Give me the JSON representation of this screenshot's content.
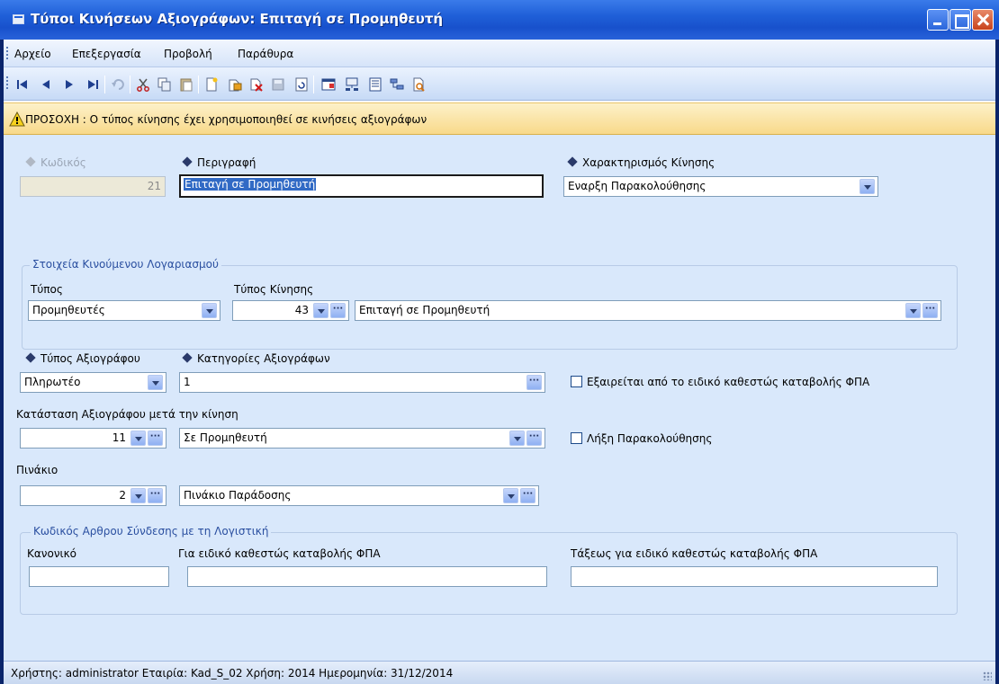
{
  "window": {
    "title": "Τύποι Κινήσεων Αξιογράφων: Επιταγή σε Προμηθευτή"
  },
  "menu": {
    "items": [
      {
        "label": "Αρχείο"
      },
      {
        "label": "Επεξεργασία"
      },
      {
        "label": "Προβολή"
      },
      {
        "label": "Παράθυρα"
      }
    ]
  },
  "toolbar": {
    "icons": [
      "first-icon",
      "previous-icon",
      "next-icon",
      "last-icon",
      "undo-icon",
      "cut-icon",
      "copy-icon",
      "paste-icon",
      "new-icon",
      "new-copy-icon",
      "delete-icon",
      "save-icon",
      "refresh-icon",
      "form-icon",
      "network-icon",
      "list-icon",
      "tree-icon",
      "report-icon"
    ]
  },
  "warning": {
    "text": "ΠΡΟΣΟΧΗ : Ο τύπος κίνησης έχει χρησιμοποιηθεί σε κινήσεις αξιογράφων"
  },
  "form": {
    "code": {
      "label": "Κωδικός",
      "value": "21"
    },
    "description": {
      "label": "Περιγραφή",
      "value": "Επιταγή σε Προμηθευτή"
    },
    "movement_char": {
      "label": "Χαρακτηρισμός Κίνησης",
      "value": "Εναρξη Παρακολούθησης"
    },
    "account_group": {
      "title": "Στοιχεία Κινούμενου Λογαριασμού",
      "type_label": "Τύπος",
      "type_value": "Προμηθευτές",
      "movement_type_label": "Τύπος Κίνησης",
      "movement_type_code": "43",
      "movement_type_desc": "Επιταγή σε Προμηθευτή"
    },
    "doc_type": {
      "label": "Τύπος Αξιογράφου",
      "value": "Πληρωτέο"
    },
    "doc_categories": {
      "label": "Κατηγορίες Αξιογράφων",
      "value": "1"
    },
    "vat_exempt": {
      "label": "Εξαιρείται από το ειδικό καθεστώς καταβολής ΦΠΑ",
      "checked": false
    },
    "state_after": {
      "label": "Κατάσταση Αξιογράφου μετά την κίνηση",
      "code": "11",
      "desc": "Σε Προμηθευτή"
    },
    "end_tracking": {
      "label": "Λήξη Παρακολούθησης",
      "checked": false
    },
    "board": {
      "label": "Πινάκιο",
      "code": "2",
      "desc": "Πινάκιο Παράδοσης"
    },
    "accounting_group": {
      "title": "Κωδικός Αρθρου Σύνδεσης με τη Λογιστική",
      "normal_label": "Κανονικό",
      "normal_value": "",
      "special_label": "Για ειδικό καθεστώς καταβολής ΦΠΑ",
      "special_value": "",
      "orders_label": "Τάξεως για ειδικό καθεστώς καταβολής ΦΠΑ",
      "orders_value": ""
    }
  },
  "status": {
    "text": "Χρήστης: administrator   Εταιρία: Kad_S_02   Χρήση: 2014   Ημερομηνία: 31/12/2014"
  }
}
